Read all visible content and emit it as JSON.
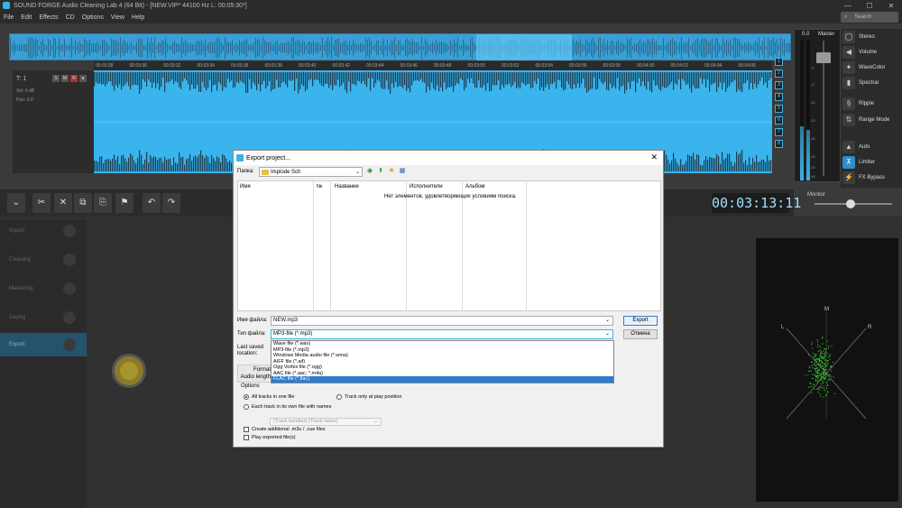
{
  "app": {
    "title": "SOUND FORGE Audio Cleaning Lab 4 (64 Bit) - [NEW.VIP*   44100 Hz L: 00:05:30*]",
    "search_placeholder": "Search",
    "menu": [
      "File",
      "Edit",
      "Effects",
      "CD",
      "Options",
      "View",
      "Help"
    ],
    "window_controls": [
      "—",
      "☐",
      "✕"
    ]
  },
  "ruler": [
    "00:03:28",
    "00:03:30",
    "00:03:32",
    "00:03:34",
    "00:03:36",
    "00:03:38",
    "00:03:40",
    "00:03:42",
    "00:03:44",
    "00:03:46",
    "00:03:48",
    "00:03:50",
    "00:03:52",
    "00:03:54",
    "00:03:56",
    "00:03:58",
    "00:04:00",
    "00:04:02",
    "00:04:04",
    "00:04:06"
  ],
  "track": {
    "name": "T: 1",
    "buttons": [
      "S",
      "M",
      "R",
      "●"
    ],
    "vol_label": "Vol: 0 dB",
    "pan_label": "Pan: 0.0"
  },
  "side_buttons": [
    "1",
    "2",
    "3",
    "4",
    "5",
    "6",
    "7",
    "8"
  ],
  "master": {
    "level": "0.0",
    "label": "Master",
    "scale": [
      "0",
      "-6",
      "-12",
      "-20",
      "-30",
      "-40",
      "-50",
      "-60"
    ]
  },
  "fx": [
    {
      "icon": "◯",
      "label": "Stereo",
      "on": false
    },
    {
      "icon": "◀",
      "label": "Volume",
      "on": false
    },
    {
      "icon": "✦",
      "label": "WaveColor",
      "on": false
    },
    {
      "icon": "▮",
      "label": "Spectral",
      "on": false
    },
    {
      "icon": "§",
      "label": "Ripple",
      "on": false
    },
    {
      "icon": "⇅",
      "label": "Range Mode",
      "on": false
    },
    {
      "icon": "▲",
      "label": "Auto",
      "on": false
    },
    {
      "icon": "⊼",
      "label": "Limiter",
      "on": true
    },
    {
      "icon": "⚡",
      "label": "FX Bypass",
      "on": false
    }
  ],
  "toolbar": {
    "buttons": [
      "⌄",
      "✂",
      "✕",
      "⧉",
      "⎘",
      "⚑",
      "↶",
      "↷"
    ],
    "timecode": "00:03:13:11",
    "monitor_label": "Monitor"
  },
  "nav": [
    {
      "label": "Import",
      "sel": false
    },
    {
      "label": "Cleaning",
      "sel": false
    },
    {
      "label": "Mastering",
      "sel": false
    },
    {
      "label": "Saving",
      "sel": false
    },
    {
      "label": "Export",
      "sel": true
    }
  ],
  "dialog": {
    "title": "Export project...",
    "folder_label": "Папка:",
    "folder_value": "Implode Sch",
    "columns": [
      "Имя",
      "№",
      "Название",
      "Исполнители",
      "Альбом"
    ],
    "empty_message": "Нет элементов, удовлетворяющих условиям поиска.",
    "filename_label": "Имя файла:",
    "filename_value": "NEW.mp3",
    "filetype_label": "Тип файла:",
    "filetype_value": "MP3-file (*.mp3)",
    "filetype_options": [
      {
        "label": "Wave file (*.wav)",
        "sel": false
      },
      {
        "label": "MP3-file (*.mp3)",
        "sel": false
      },
      {
        "label": "Windows Media audio file (*.wma)",
        "sel": false
      },
      {
        "label": "AIFF file (*.aif)",
        "sel": false
      },
      {
        "label": "Ogg Vorbis file (*.ogg)",
        "sel": false
      },
      {
        "label": "AAC file (*.aac; *.m4a)",
        "sel": false
      },
      {
        "label": "FLAC file (*.flac)",
        "sel": true
      }
    ],
    "export_button": "Export",
    "cancel_button": "Отмена",
    "last_saved_label": "Last saved location:",
    "format_label": "Format",
    "audio_length_label": "Audio length",
    "options_label": "Options",
    "radio_all_tracks": "All tracks in one file",
    "radio_play_position": "Track only at play position",
    "radio_each_track": "Each track in its own file with names",
    "track_template": "(Track number) (Track name)",
    "chk_m3u": "Create additional .m3u / .cue files",
    "chk_play_exported": "Play exported file(s)"
  },
  "scope": {
    "left": "L",
    "mid": "M",
    "right": "R"
  },
  "colors": {
    "accent": "#3ab0e8",
    "selected": "#2d7ccf"
  }
}
